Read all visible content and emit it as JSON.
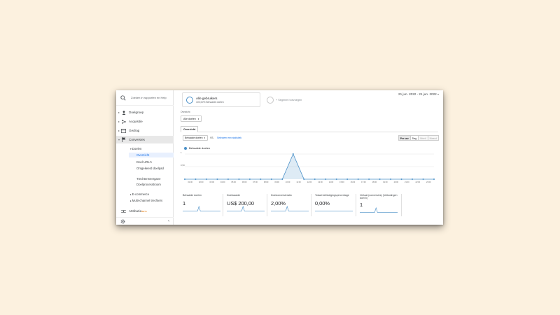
{
  "sidebar": {
    "search_placeholder": "Zoeken in rapporten en Help",
    "items": [
      {
        "label": "Doelgroep",
        "icon": "person-icon"
      },
      {
        "label": "Acquisitie",
        "icon": "acquisition-icon"
      },
      {
        "label": "Gedrag",
        "icon": "behavior-icon"
      },
      {
        "label": "Conversies",
        "icon": "flag-icon"
      }
    ],
    "doelen_label": "Doelen",
    "subitems": [
      "Overzicht",
      "Doel-URL's",
      "Omgekeerd doelpad",
      "Trechterweergave",
      "Doelprocesstroom"
    ],
    "ecommerce_label": "E-commerce",
    "multichannel_label": "Multi-channel trechters",
    "attributie_label": "Attributie",
    "beta_label": "BETA"
  },
  "segments": {
    "segment1_title": "Alle gebruikers",
    "segment1_sub": "100,00% Behaalde doelen",
    "add_segment": "+ Segment toevoegen"
  },
  "date_range": "21 jun. 2022 - 21 jun. 2022",
  "view": {
    "label": "Overzicht",
    "dropdown": "Alle doelen"
  },
  "tabs": {
    "overview": "Overzicht"
  },
  "controls": {
    "metric_select": "Behaalde doelen",
    "vs": "VS.",
    "select_metric": "Selecteer een statistiek",
    "granularity": [
      "Per uur",
      "Dag",
      "Week",
      "Maand"
    ]
  },
  "legend": {
    "label": "Behaalde doelen"
  },
  "chart_data": {
    "type": "area",
    "x": [
      "01:00",
      "02:00",
      "03:00",
      "04:00",
      "05:00",
      "06:00",
      "07:00",
      "08:00",
      "09:00",
      "10:00",
      "11:00",
      "12:00",
      "13:00",
      "14:00",
      "15:00",
      "16:00",
      "17:00",
      "18:00",
      "19:00",
      "20:00",
      "21:00",
      "22:00",
      "23:00"
    ],
    "series": [
      {
        "name": "Behaalde doelen",
        "values": [
          0,
          0,
          0,
          0,
          0,
          0,
          0,
          0,
          0,
          0,
          1,
          0,
          0,
          0,
          0,
          0,
          0,
          0,
          0,
          0,
          0,
          0,
          0,
          0
        ]
      }
    ],
    "ytick_labels": [
      "1",
      "0,50"
    ],
    "ylim": [
      0,
      1
    ],
    "color": "#4a90c8"
  },
  "scorecards": [
    {
      "label": "Behaalde doelen",
      "value": "1",
      "spark_peak": 10
    },
    {
      "label": "Doelwaarde",
      "value": "US$ 200,00",
      "spark_peak": 10
    },
    {
      "label": "Doelconversieratio",
      "value": "2,00%",
      "spark_peak": 10
    },
    {
      "label": "Totaal beëindigingspercentage",
      "value": "0,00%",
      "spark_peak": null
    },
    {
      "label": "Verlaat (conversies) (Voltooiingen doel 5)",
      "value": "1",
      "spark_peak": 10
    }
  ]
}
